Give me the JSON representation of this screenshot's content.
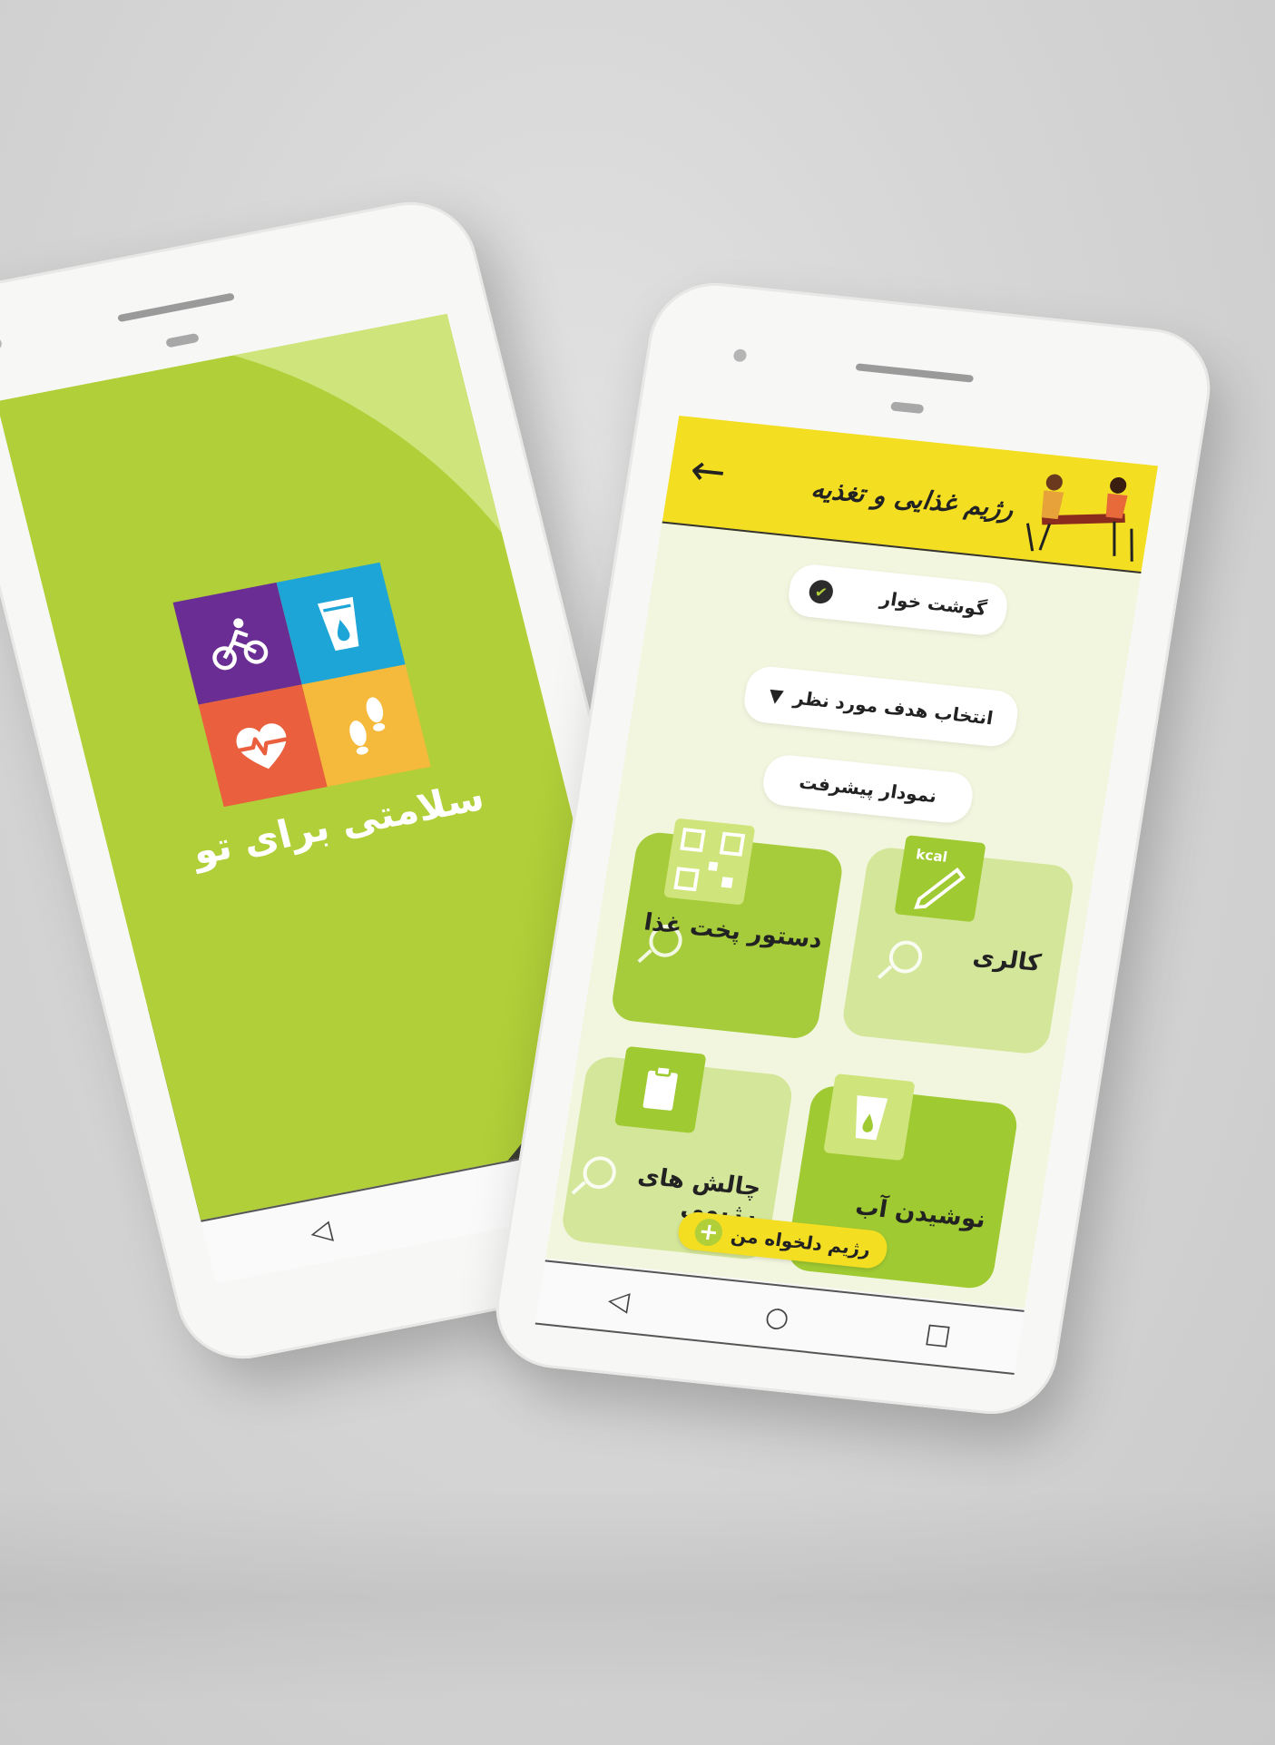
{
  "splash": {
    "title": "سلامتی برای تو",
    "tiles": [
      "cycling-icon",
      "water-glass-icon",
      "heart-pulse-icon",
      "footprints-icon"
    ],
    "colors": {
      "background": "#b0cf38",
      "light_arc": "#cfe57c",
      "dark_band": "#3a3d32",
      "purple": "#6a2d93",
      "blue": "#1ea5d8",
      "red": "#ea5f3d",
      "orange": "#f5b93b"
    }
  },
  "app": {
    "header": {
      "title": "رژیم غذایی و تغذیه",
      "back_icon": "arrow-left-icon"
    },
    "diet_type": {
      "label": "گوشت خوار"
    },
    "goal_select": {
      "label": "انتخاب هدف مورد نظر"
    },
    "progress_button": {
      "label": "نمودار پیشرفت"
    },
    "cards": {
      "calorie": {
        "label": "کالری",
        "badge": "kcal"
      },
      "recipe": {
        "label": "دستور پخت غذا"
      },
      "water": {
        "label": "نوشیدن آب"
      },
      "challenge": {
        "label": "چالش های رژیمی"
      }
    },
    "my_diet_button": {
      "label": "رژیم دلخواه من",
      "icon": "plus-icon"
    },
    "colors": {
      "header_yellow": "#f3de22",
      "screen_bg": "#f3f6df",
      "green": "#9fca32",
      "pale_green": "#d4e69a"
    }
  },
  "navbar": {
    "back": "◁",
    "home": "○",
    "recent": "□"
  }
}
